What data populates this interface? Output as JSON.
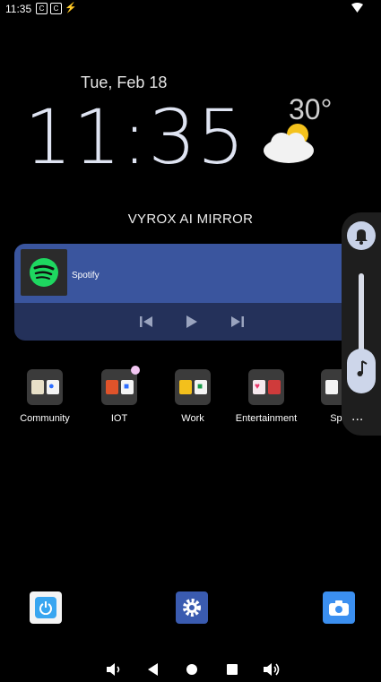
{
  "status_bar": {
    "time": "11:35",
    "icons": [
      "notification-icon",
      "notification-icon",
      "cast-icon",
      "wifi-icon"
    ]
  },
  "clock": {
    "date": "Tue, Feb 18",
    "time": "11:35",
    "temperature": "30°",
    "weather_icon": "partly-cloudy-icon"
  },
  "brand": "VYROX AI MIRROR",
  "media": {
    "app_label": "Spotify",
    "controls": [
      "previous-icon",
      "play-icon",
      "next-icon"
    ],
    "colors": {
      "top": "#3a559e",
      "bottom": "#24315a"
    }
  },
  "apps": [
    {
      "label": "Community"
    },
    {
      "label": "IOT"
    },
    {
      "label": "Work"
    },
    {
      "label": "Entertainment"
    },
    {
      "label": "Spa"
    }
  ],
  "volume_panel": {
    "more_label": "...",
    "level": 0.15
  },
  "dock": [
    "power-app-icon",
    "settings-app-icon",
    "camera-app-icon"
  ],
  "nav_bar": [
    "volume-down-icon",
    "back-icon",
    "home-icon",
    "recents-icon",
    "volume-up-icon"
  ]
}
